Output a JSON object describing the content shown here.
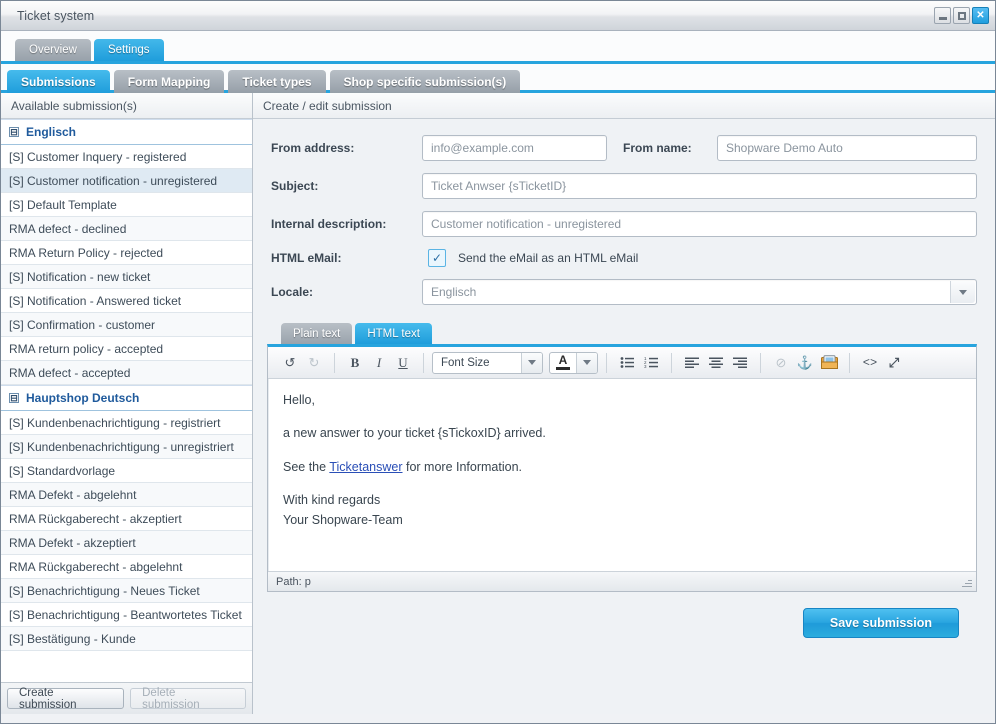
{
  "window": {
    "title": "Ticket system",
    "controls": {
      "minimize": "–",
      "maximize": "□",
      "close": "✕"
    }
  },
  "top_tabs": [
    {
      "label": "Overview",
      "active": false
    },
    {
      "label": "Settings",
      "active": true
    }
  ],
  "sub_tabs": [
    {
      "label": "Submissions",
      "active": true
    },
    {
      "label": "Form Mapping",
      "active": false
    },
    {
      "label": "Ticket types",
      "active": false
    },
    {
      "label": "Shop specific submission(s)",
      "active": false
    }
  ],
  "sidebar": {
    "header": "Available submission(s)",
    "groups": [
      {
        "label": "Englisch",
        "expander": "⊟",
        "items": [
          {
            "label": "[S] Customer Inquery - registered",
            "selected": false
          },
          {
            "label": "[S] Customer notification - unregistered",
            "selected": true
          },
          {
            "label": "[S] Default Template",
            "selected": false
          },
          {
            "label": "RMA defect - declined",
            "selected": false
          },
          {
            "label": "RMA Return Policy - rejected",
            "selected": false
          },
          {
            "label": "[S] Notification - new ticket",
            "selected": false
          },
          {
            "label": "[S] Notification - Answered ticket",
            "selected": false
          },
          {
            "label": "[S] Confirmation - customer",
            "selected": false
          },
          {
            "label": "RMA return policy - accepted",
            "selected": false
          },
          {
            "label": "RMA defect - accepted",
            "selected": false
          }
        ]
      },
      {
        "label": "Hauptshop Deutsch",
        "expander": "⊟",
        "items": [
          {
            "label": "[S] Kundenbenachrichtigung - registriert",
            "selected": false
          },
          {
            "label": "[S] Kundenbenachrichtigung - unregistriert",
            "selected": false
          },
          {
            "label": "[S] Standardvorlage",
            "selected": false
          },
          {
            "label": "RMA Defekt - abgelehnt",
            "selected": false
          },
          {
            "label": "RMA Rückgaberecht - akzeptiert",
            "selected": false
          },
          {
            "label": "RMA Defekt - akzeptiert",
            "selected": false
          },
          {
            "label": "RMA Rückgaberecht - abgelehnt",
            "selected": false
          },
          {
            "label": "[S] Benachrichtigung - Neues Ticket",
            "selected": false
          },
          {
            "label": "[S] Benachrichtigung - Beantwortetes Ticket",
            "selected": false
          },
          {
            "label": "[S] Bestätigung - Kunde",
            "selected": false
          }
        ]
      }
    ],
    "footer": {
      "create_label": "Create submission",
      "delete_label": "Delete submission"
    }
  },
  "detail": {
    "header": "Create / edit submission",
    "fields": {
      "from_address_label": "From address:",
      "from_address_value": "info@example.com",
      "from_name_label": "From name:",
      "from_name_value": "Shopware Demo Auto",
      "subject_label": "Subject:",
      "subject_value": "Ticket Anwser {sTicketID}",
      "internal_description_label": "Internal description:",
      "internal_description_value": "Customer notification - unregistered",
      "html_email_label": "HTML eMail:",
      "html_email_checked": "✓",
      "html_email_text": "Send the eMail as an HTML eMail",
      "locale_label": "Locale:",
      "locale_value": "Englisch"
    },
    "editor": {
      "tabs": [
        {
          "label": "Plain text",
          "active": false
        },
        {
          "label": "HTML text",
          "active": true
        }
      ],
      "toolbar": {
        "undo": "↺",
        "redo": "↻",
        "bold": "B",
        "italic": "I",
        "underline": "U",
        "font_size": "Font Size",
        "font_color_glyph": "A",
        "bullet_list": "•≡",
        "numbered_list": "1≡",
        "align_left": "≡",
        "align_center": "≡",
        "align_right": "≡",
        "unlink": "⊘",
        "anchor": "⚓",
        "image": "🖼",
        "source_code": "<>",
        "fullscreen": "⤢"
      },
      "content": {
        "line1": "Hello,",
        "line2": "a new answer to your ticket {sTickoxID} arrived.",
        "line3_pre": "See the ",
        "line3_link": "Ticketanswer",
        "line3_post": " for more Information.",
        "line4": "With kind regards",
        "line5": "Your Shopware-Team"
      },
      "path_bar": "Path: p"
    },
    "save_label": "Save submission"
  },
  "colors": {
    "accent": "#27a4de",
    "tab_inactive": "#9aa3ac",
    "link": "#2a4fb7",
    "selected_row": "#dfeaf3",
    "group_text": "#1f5a9c"
  }
}
